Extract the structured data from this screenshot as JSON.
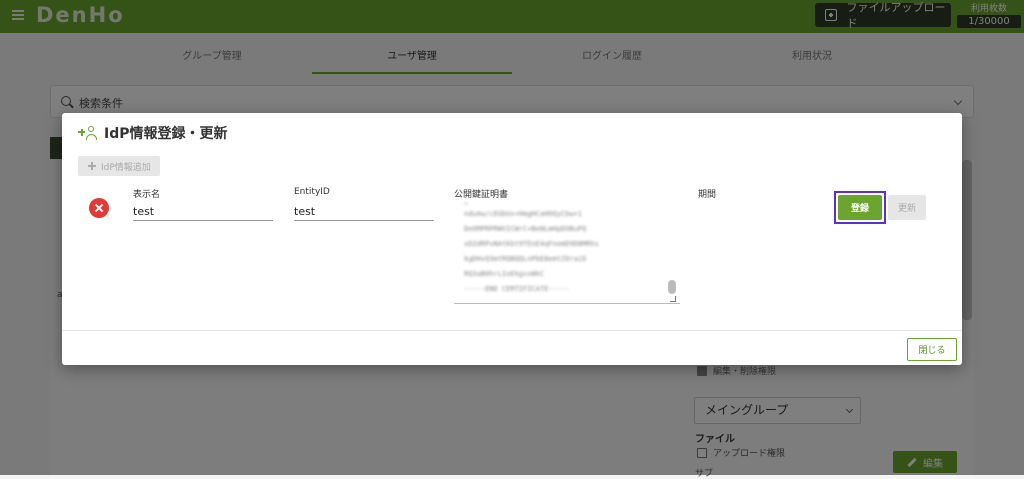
{
  "header": {
    "logo": "DenHo",
    "upload_label": "ファイルアップロード",
    "usage_label": "利用枚数",
    "usage_count": "1/30000"
  },
  "nav": {
    "tabs": [
      {
        "label": "グループ管理",
        "active": false
      },
      {
        "label": "ユーザ管理",
        "active": true
      },
      {
        "label": "ログイン履歴",
        "active": false
      },
      {
        "label": "利用状況",
        "active": false
      }
    ]
  },
  "search": {
    "label": "検索条件"
  },
  "background": {
    "edit_delete_perm": "編集・削除権限",
    "group_select": "メイングループ",
    "file_section": "ファイル",
    "upload_perm": "アップロード権限",
    "edit_button": "編集",
    "cut_off_text": "サブ",
    "left_char": "a"
  },
  "modal": {
    "title": "IdP情報登録・更新",
    "add_idp_label": "IdP情報追加",
    "fields": {
      "display_name_label": "表示名",
      "display_name_value": "test",
      "entity_id_label": "EntityID",
      "entity_id_value": "test",
      "cert_label": "公開鍵証明書",
      "period_label": "期間"
    },
    "cert_lines": [
      "~",
      "nduAw/cEGbUx+HmgHCaHOQyCbw+1",
      "DeOMPRPRWVICWrC+BeNLmHpDOBuPQ",
      "xD2dRPvNAtKbt9TEnE4qFnemD9D8MRhs",
      "kgDHvQ3mtRQBQQLnPbE8emtZ0raiD",
      "RQ3aB0hrLIoEkgvxWkC",
      "-----END CERTIFICATE-----"
    ],
    "register_label": "登録",
    "update_label": "更新",
    "close_label": "閉じる"
  }
}
